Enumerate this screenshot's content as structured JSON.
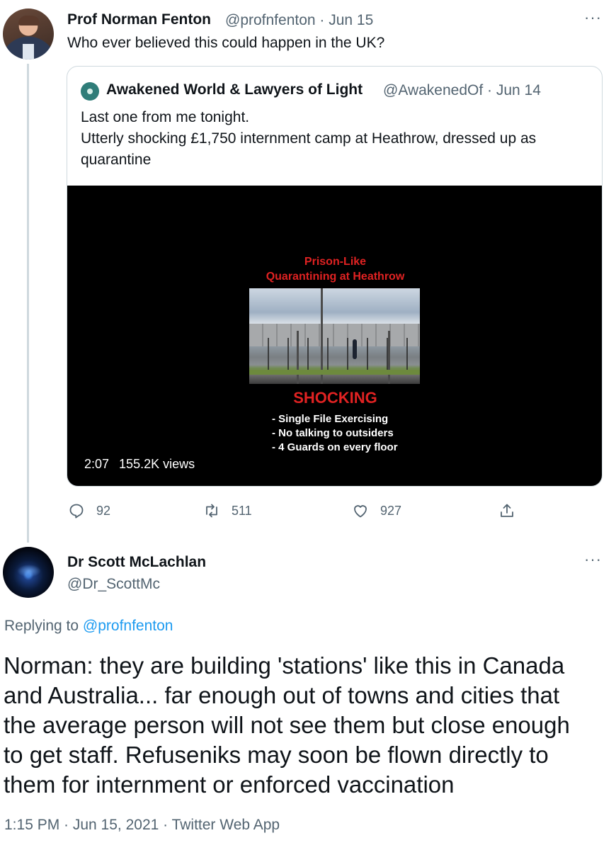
{
  "tweet": {
    "author_name": "Prof Norman Fenton",
    "meta": "@profnfenton · Jun 15",
    "text": "Who ever believed this could happen in the UK?",
    "more": "···"
  },
  "quoted": {
    "author_name": "Awakened World & Lawyers of Light",
    "meta": "@AwakenedOf · Jun 14",
    "text_lines": [
      "Last one from me tonight.",
      "Utterly shocking £1,750 internment camp at Heathrow, dressed up as",
      "quarantine"
    ],
    "video": {
      "title_line1": "Prison-Like",
      "title_line2": "Quarantining at Heathrow",
      "headline": "SHOCKING",
      "bullets": [
        "- Single File Exercising",
        "- No talking to outsiders",
        "- 4 Guards on every floor"
      ],
      "duration": "2:07",
      "views": "155.2K views"
    }
  },
  "actions": {
    "reply_count": "92",
    "retweet_count": "511",
    "like_count": "927"
  },
  "reply": {
    "author_name": "Dr Scott McLachlan",
    "handle": "@Dr_ScottMc",
    "more": "···",
    "replying_prefix": "Replying to",
    "replying_to": "@profnfenton",
    "text_lines": [
      "Norman: they are building 'stations' like this in Canada",
      "and Australia... far enough out of towns and cities that",
      "the average person will not see them but close enough",
      "to get staff. Refuseniks may soon be flown directly to",
      "them for internment or enforced vaccination"
    ],
    "footer": "1:15 PM · Jun 15, 2021 · Twitter Web App"
  },
  "icons": [
    "reply-icon",
    "retweet-icon",
    "like-icon",
    "share-icon",
    "more-icon"
  ],
  "colors": {
    "text": "#0f1419",
    "secondary": "#536471",
    "link": "#1d9bf0",
    "border": "#cfd9de",
    "video_red": "#e02222"
  }
}
